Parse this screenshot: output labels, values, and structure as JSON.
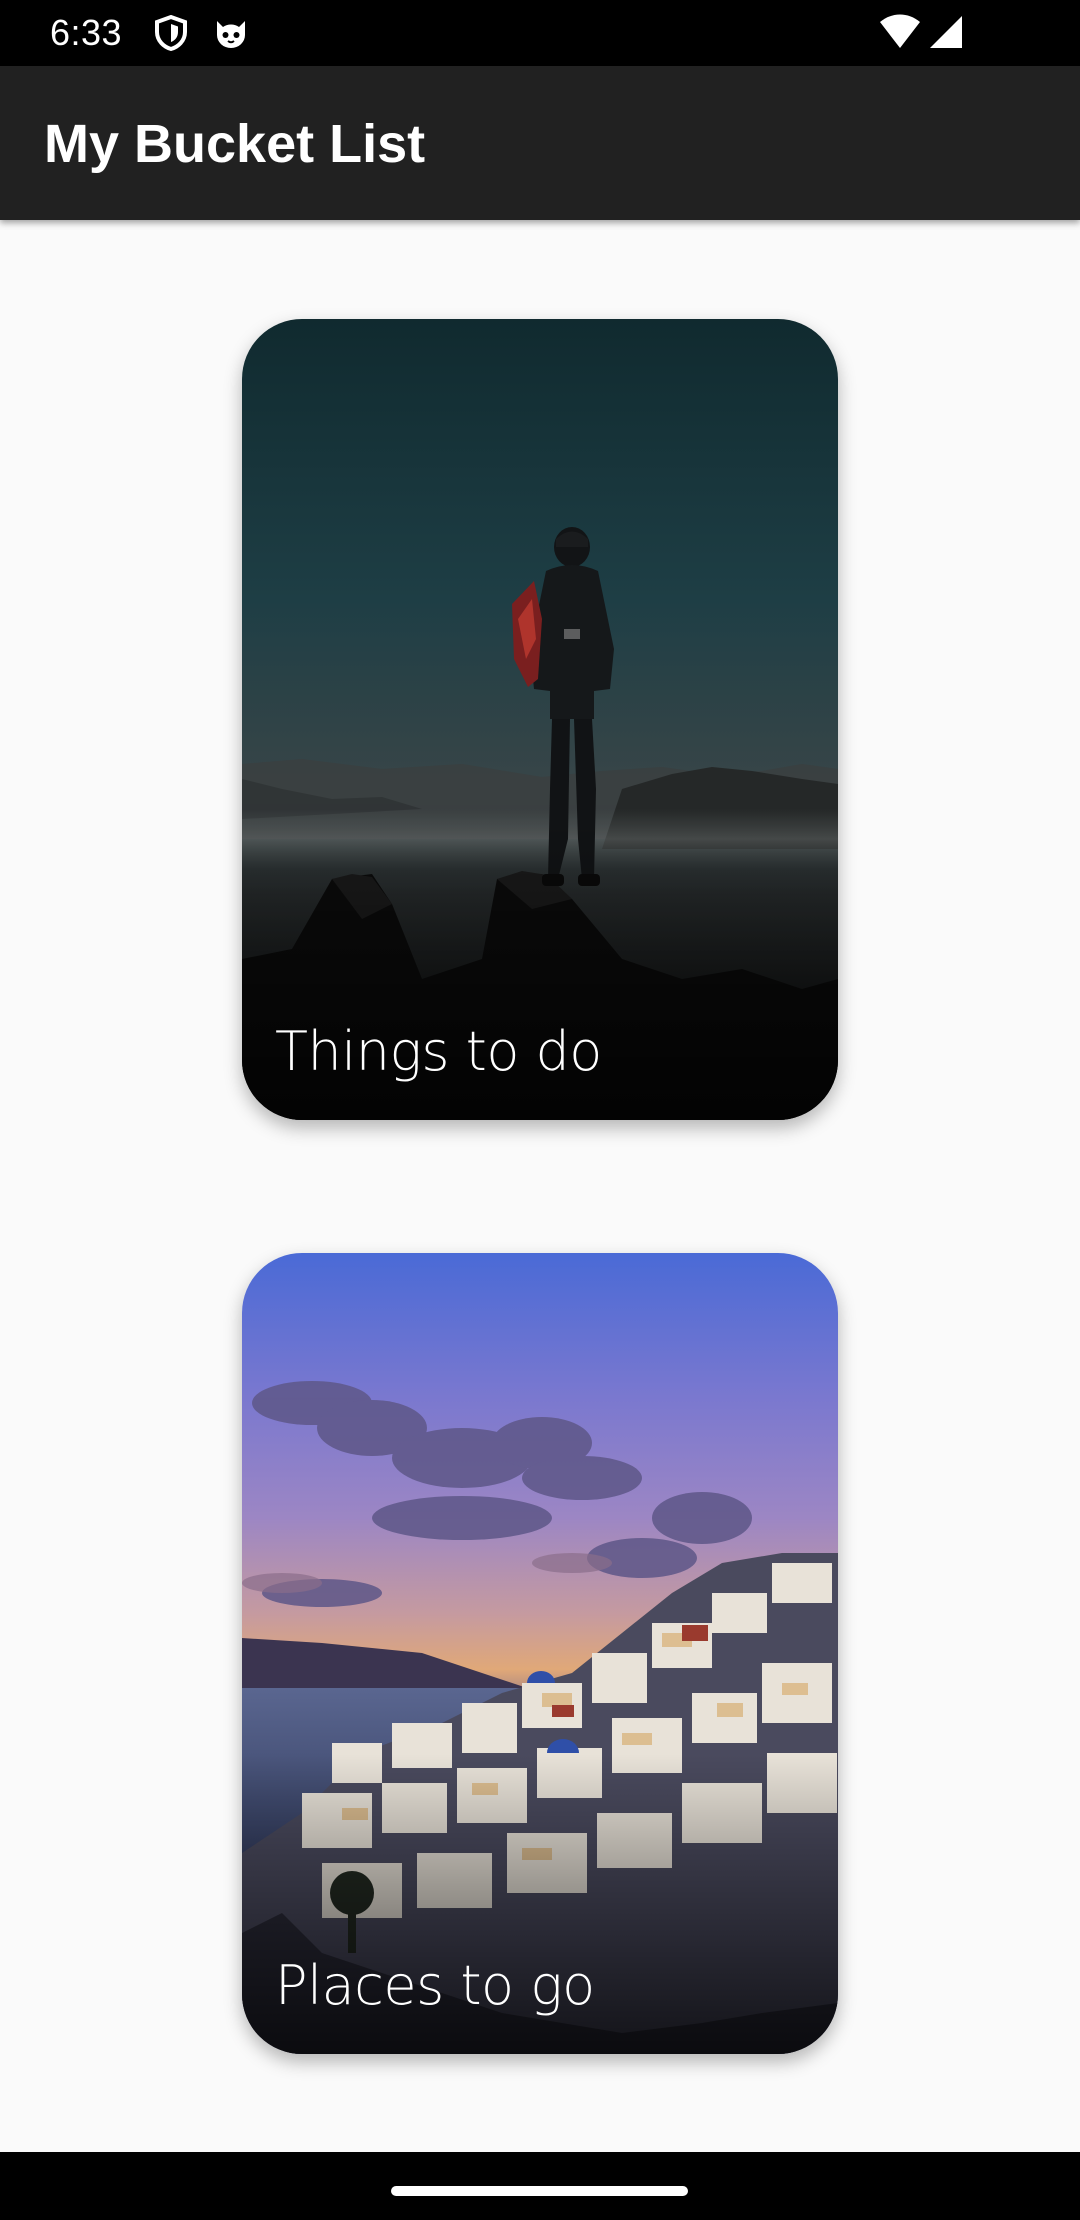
{
  "status_bar": {
    "time": "6:33",
    "icons": [
      "shield-icon",
      "cat-face-icon",
      "wifi-icon",
      "cellular-signal-icon"
    ]
  },
  "app_bar": {
    "title": "My Bucket List",
    "background": "#212121"
  },
  "cards": [
    {
      "label": "Things to do",
      "image": "hiker-on-mountain-at-dusk"
    },
    {
      "label": "Places to go",
      "image": "santorini-village-at-sunset"
    }
  ],
  "colors": {
    "page_background": "#fafafa",
    "system_bars": "#000000",
    "card_text": "#ffffff"
  }
}
